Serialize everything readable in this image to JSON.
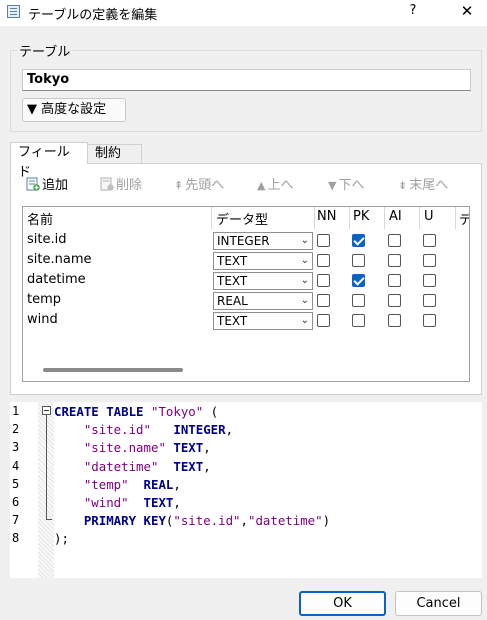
{
  "window": {
    "title": "テーブルの定義を編集",
    "help": "?",
    "close": "✕"
  },
  "table_group": {
    "label": "テーブル",
    "name_value": "Tokyo",
    "advanced_label": "高度な設定",
    "advanced_icon": "▼"
  },
  "tabs": [
    {
      "label": "フィールド",
      "active": true
    },
    {
      "label": "制約",
      "active": false
    }
  ],
  "toolbar": {
    "add": "追加",
    "delete": "削除",
    "top": "先頭へ",
    "up": "上へ",
    "down": "下へ",
    "bottom": "末尾へ"
  },
  "grid": {
    "headers": [
      "名前",
      "データ型",
      "NN",
      "PK",
      "AI",
      "U",
      "デ"
    ],
    "rows": [
      {
        "name": "site.id",
        "type": "INTEGER",
        "nn": false,
        "pk": true,
        "ai": false,
        "u": false
      },
      {
        "name": "site.name",
        "type": "TEXT",
        "nn": false,
        "pk": false,
        "ai": false,
        "u": false
      },
      {
        "name": "datetime",
        "type": "TEXT",
        "nn": false,
        "pk": true,
        "ai": false,
        "u": false
      },
      {
        "name": "temp",
        "type": "REAL",
        "nn": false,
        "pk": false,
        "ai": false,
        "u": false
      },
      {
        "name": "wind",
        "type": "TEXT",
        "nn": false,
        "pk": false,
        "ai": false,
        "u": false
      }
    ]
  },
  "editor": {
    "line_numbers": [
      "1",
      "2",
      "3",
      "4",
      "5",
      "6",
      "7",
      "8"
    ],
    "lines": [
      [
        [
          "kw",
          "CREATE TABLE "
        ],
        [
          "str",
          "\"Tokyo\""
        ],
        [
          "pn",
          " ("
        ]
      ],
      [
        [
          "pn",
          "    "
        ],
        [
          "str",
          "\"site.id\""
        ],
        [
          "pn",
          "   "
        ],
        [
          "kw",
          "INTEGER"
        ],
        [
          "pn",
          ","
        ]
      ],
      [
        [
          "pn",
          "    "
        ],
        [
          "str",
          "\"site.name\""
        ],
        [
          "pn",
          " "
        ],
        [
          "kw",
          "TEXT"
        ],
        [
          "pn",
          ","
        ]
      ],
      [
        [
          "pn",
          "    "
        ],
        [
          "str",
          "\"datetime\""
        ],
        [
          "pn",
          "  "
        ],
        [
          "kw",
          "TEXT"
        ],
        [
          "pn",
          ","
        ]
      ],
      [
        [
          "pn",
          "    "
        ],
        [
          "str",
          "\"temp\""
        ],
        [
          "pn",
          "  "
        ],
        [
          "kw",
          "REAL"
        ],
        [
          "pn",
          ","
        ]
      ],
      [
        [
          "pn",
          "    "
        ],
        [
          "str",
          "\"wind\""
        ],
        [
          "pn",
          "  "
        ],
        [
          "kw",
          "TEXT"
        ],
        [
          "pn",
          ","
        ]
      ],
      [
        [
          "pn",
          "    "
        ],
        [
          "kw",
          "PRIMARY KEY"
        ],
        [
          "pn",
          "("
        ],
        [
          "str",
          "\"site.id\""
        ],
        [
          "pn",
          ","
        ],
        [
          "str",
          "\"datetime\""
        ],
        [
          "pn",
          ")"
        ]
      ],
      [
        [
          "pn",
          ");"
        ]
      ]
    ]
  },
  "buttons": {
    "ok": "OK",
    "cancel": "Cancel"
  },
  "colors": {
    "accent": "#0a62c9",
    "keyword": "#00008b",
    "string": "#800080"
  }
}
